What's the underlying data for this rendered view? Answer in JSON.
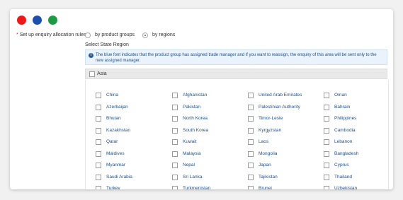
{
  "window_controls": [
    "close",
    "minimize",
    "maximize"
  ],
  "allocation": {
    "required_mark": "*",
    "label": "Set up enquiry allocation rules",
    "options": [
      {
        "label": "by product groups",
        "selected": false
      },
      {
        "label": "by regions",
        "selected": true
      }
    ]
  },
  "region_section": {
    "title": "Select State Region",
    "notice_icon": "i",
    "notice": "The blue font indicates that the product group has assigned trade manager and if you want to reassign, the enquiry of this area will be sent only to the new assigned manager.",
    "region_name": "Asia",
    "countries": [
      [
        "China",
        "Afghanistan",
        "United Arab Emirates",
        "Oman"
      ],
      [
        "Azerbaijan",
        "Pakistan",
        "Palestinian Authority",
        "Bahrain"
      ],
      [
        "Bhutan",
        "North Korea",
        "Timor-Leste",
        "Philippines"
      ],
      [
        "Kazakhstan",
        "South Korea",
        "Kyrgyzstan",
        "Cambodia"
      ],
      [
        "Qatar",
        "Kuwait",
        "Laos",
        "Lebanon"
      ],
      [
        "Maldives",
        "Malaysia",
        "Mongolia",
        "Bangladesh"
      ],
      [
        "Myanmar",
        "Nepal",
        "Japan",
        "Cyprus"
      ],
      [
        "Saudi Arabia",
        "Sri Lanka",
        "Tajikistan",
        "Thailand"
      ],
      [
        "Turkey",
        "Turkmenistan",
        "Brunei",
        "Uzbekistan"
      ]
    ]
  }
}
